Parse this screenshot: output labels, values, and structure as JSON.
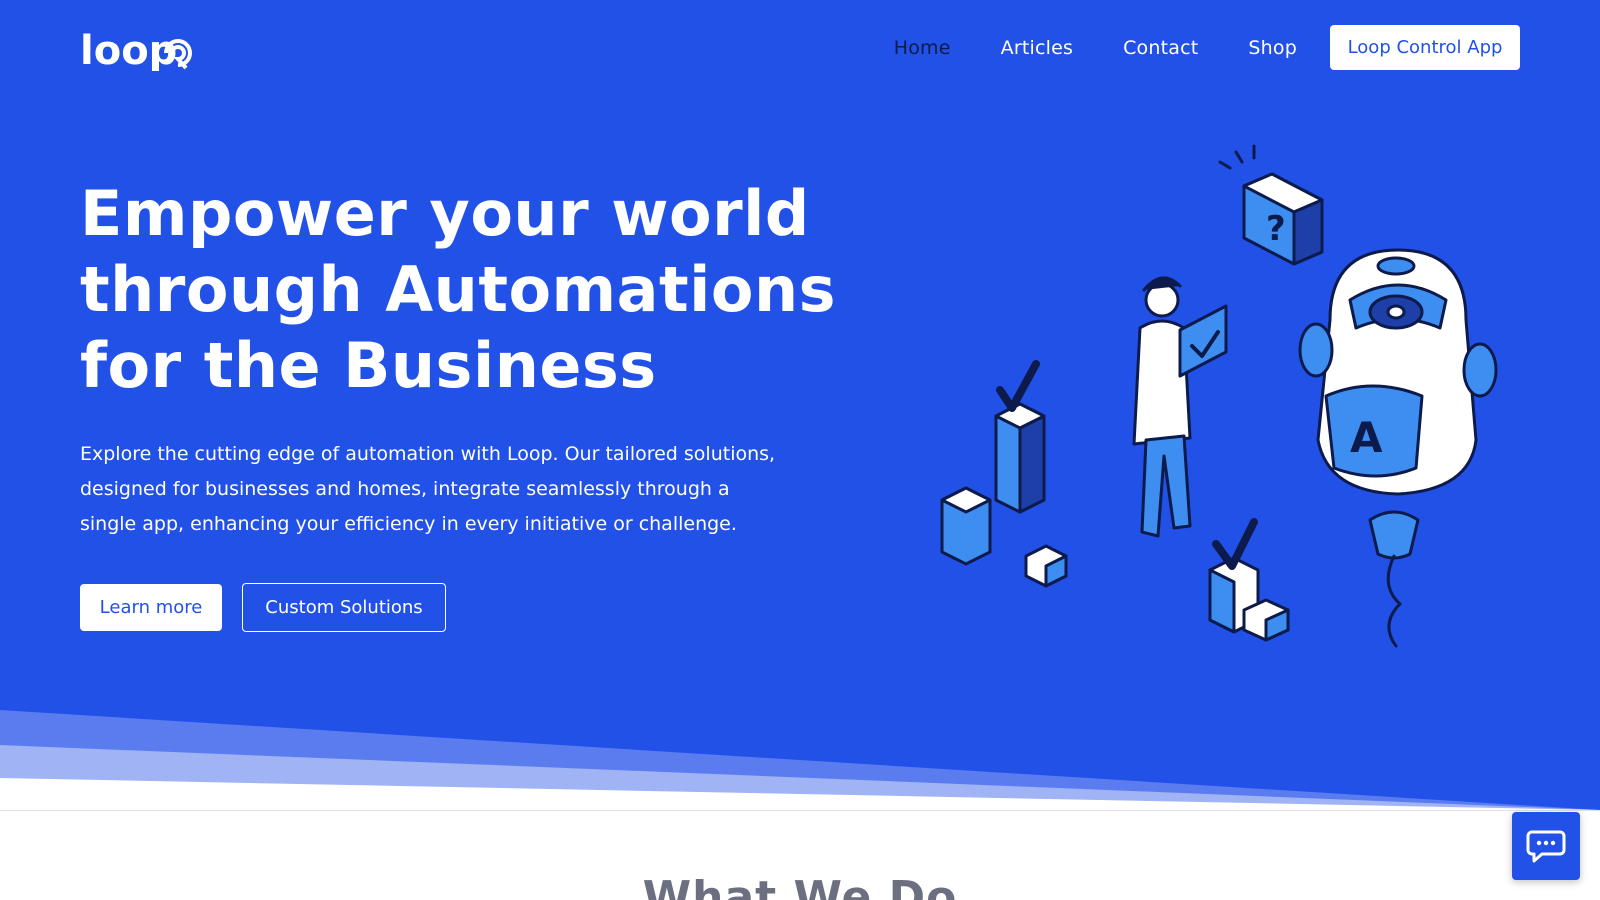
{
  "brand": {
    "logo_text": "loop"
  },
  "nav": {
    "items": [
      {
        "label": "Home",
        "active": true
      },
      {
        "label": "Articles",
        "active": false
      },
      {
        "label": "Contact",
        "active": false
      },
      {
        "label": "Shop",
        "active": false
      }
    ],
    "cta_label": "Loop Control App"
  },
  "hero": {
    "headline_lines": [
      "Empower your world",
      "through Automations",
      "for the Business"
    ],
    "subtext": "Explore the cutting edge of automation with Loop. Our tailored solutions, designed for businesses and homes, integrate seamlessly through a single app, enhancing your efficiency in every initiative or challenge.",
    "learn_more_label": "Learn more",
    "custom_solutions_label": "Custom Solutions",
    "illustration": {
      "robot_badge": "A",
      "bubble_symbol": "?"
    }
  },
  "section": {
    "title": "What We Do"
  },
  "chat": {
    "icon": "chat-bubble-icon"
  },
  "colors": {
    "primary": "#2251e8",
    "nav_active": "#0d1b4c",
    "white": "#ffffff",
    "wave_light": "#8aa2f3",
    "wave_mid": "#5a7cef"
  }
}
